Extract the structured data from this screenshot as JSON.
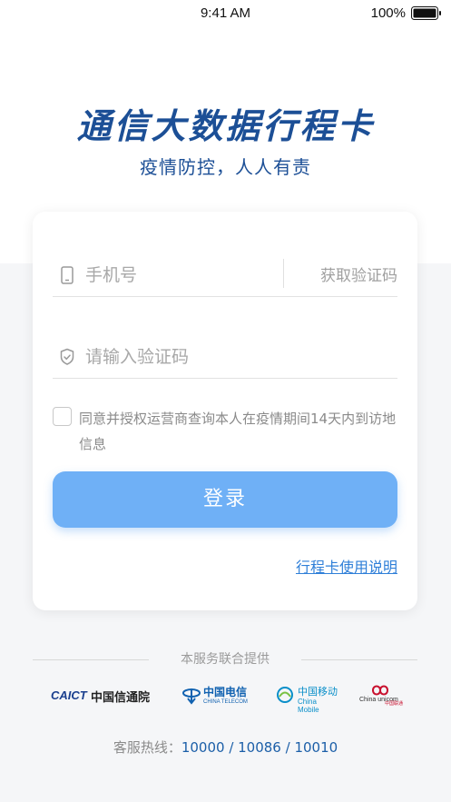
{
  "status_bar": {
    "time": "9:41 AM",
    "battery": "100%"
  },
  "header": {
    "title": "通信大数据行程卡",
    "subtitle": "疫情防控，人人有责"
  },
  "form": {
    "phone_placeholder": "手机号",
    "get_code_label": "获取验证码",
    "code_placeholder": "请输入验证码",
    "agree_text": "同意并授权运营商查询本人在疫情期间14天内到访地信息",
    "agree_checked": false,
    "login_label": "登录",
    "guide_link": "行程卡使用说明"
  },
  "footer": {
    "provider_title": "本服务联合提供",
    "logos": {
      "caict_en": "CAICT",
      "caict_cn": "中国信通院",
      "telecom_cn": "中国电信",
      "telecom_en": "CHINA TELECOM",
      "mobile_cn": "中国移动",
      "mobile_en": "China Mobile",
      "unicom_en": "China unicom",
      "unicom_cn": "中国联通"
    },
    "hotline_label": "客服热线：",
    "hotline_numbers": "10000 / 10086 / 10010"
  },
  "colors": {
    "brand_blue": "#1c4f96",
    "button_blue": "#6fb0f6",
    "link_blue": "#2f7fd8"
  },
  "icons": {
    "phone_field": "phone-icon",
    "code_field": "shield-check-icon",
    "battery": "battery-icon"
  }
}
